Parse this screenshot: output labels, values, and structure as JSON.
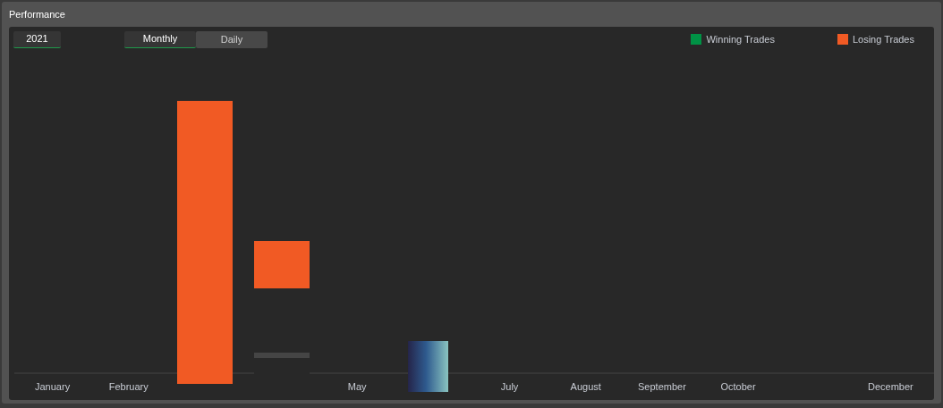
{
  "panel": {
    "title": "Performance"
  },
  "year": "2021",
  "views": [
    {
      "label": "Monthly",
      "selected": true
    },
    {
      "label": "Daily",
      "selected": false
    }
  ],
  "legend": [
    {
      "label": "Winning Trades",
      "color": "#009245"
    },
    {
      "label": "Losing Trades",
      "color": "#f15a24"
    }
  ],
  "months": [
    {
      "kind": "label",
      "text": "January"
    },
    {
      "kind": "label",
      "text": "February"
    },
    {
      "kind": "blank"
    },
    {
      "kind": "blank"
    },
    {
      "kind": "label",
      "text": "May"
    },
    {
      "kind": "blank"
    },
    {
      "kind": "label",
      "text": "July"
    },
    {
      "kind": "label",
      "text": "August"
    },
    {
      "kind": "label",
      "text": "September"
    },
    {
      "kind": "label",
      "text": "October"
    },
    {
      "kind": "blank"
    },
    {
      "kind": "label",
      "text": "December"
    }
  ]
}
